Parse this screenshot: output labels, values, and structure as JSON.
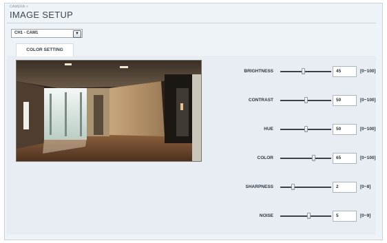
{
  "header": {
    "breadcrumb": "CAMERA >",
    "title": "IMAGE SETUP"
  },
  "channel_select": {
    "value": "CH1 - CAM1",
    "arrow_icon": "chevron-down-icon"
  },
  "tabs": [
    {
      "label": "COLOR SETTING",
      "active": true
    }
  ],
  "controls": [
    {
      "id": "brightness",
      "label": "BRIGHTNESS",
      "value": "45",
      "range": "[0~100]",
      "fraction": 0.45
    },
    {
      "id": "contrast",
      "label": "CONTRAST",
      "value": "50",
      "range": "[0~100]",
      "fraction": 0.5
    },
    {
      "id": "hue",
      "label": "HUE",
      "value": "50",
      "range": "[0~100]",
      "fraction": 0.5
    },
    {
      "id": "color",
      "label": "COLOR",
      "value": "65",
      "range": "[0~100]",
      "fraction": 0.65
    },
    {
      "id": "sharpness",
      "label": "SHARPNESS",
      "value": "2",
      "range": "[0~8]",
      "fraction": 0.25
    },
    {
      "id": "noise",
      "label": "NOISE",
      "value": "5",
      "range": "[0~9]",
      "fraction": 0.56
    }
  ],
  "colors": {
    "background": "#eef3f7",
    "track": "#3a4048"
  }
}
